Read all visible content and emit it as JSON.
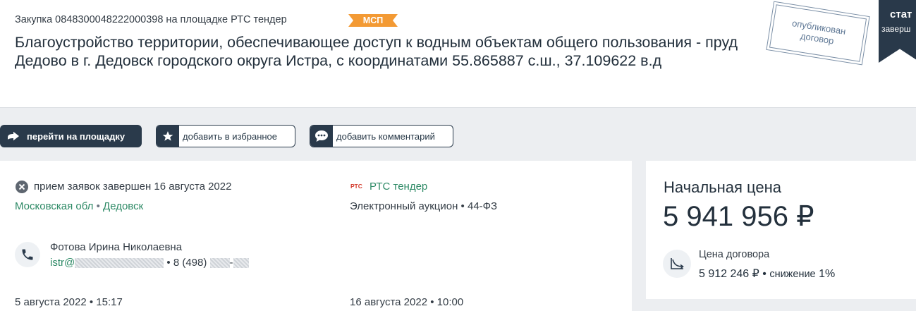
{
  "header": {
    "purchase_line": "Закупка 0848300048222000398 на площадке РТС тендер",
    "badge": "МСП",
    "title": "Благоустройство территории, обеспечивающее доступ к водным объектам общего пользования - пруд Дедово в г. Дедовск городского округа Истра, с координатами 55.865887 с.ш., 37.109622 в.д",
    "stamp": "опубликован договор",
    "status_title": "стат",
    "status_sub": "заверш"
  },
  "actions": {
    "go_platform": "перейти на площадку",
    "add_favorite": "добавить в избранное",
    "add_comment": "добавить комментарий"
  },
  "details": {
    "status_text": "прием заявок завершен 16 августа 2022",
    "region": "Московская обл",
    "separator": "•",
    "city": "Дедовск",
    "platform_logo": "РТС",
    "platform": "РТС тендер",
    "procedure": "Электронный аукцион • 44-ФЗ",
    "contact_name": "Фотова Ирина Николаевна",
    "email_prefix": "istr@",
    "phone_prefix": "• 8 (498)",
    "phone_dash": "-",
    "date_start": "5 августа 2022 • 15:17",
    "date_end": "16 августа 2022 • 10:00"
  },
  "price": {
    "label": "Начальная цена",
    "value": "5 941 956 ₽",
    "contract_label": "Цена договора",
    "contract_value": "5 912 246 ₽",
    "separator": "•",
    "reduction_label": "снижение",
    "reduction_value": "1%"
  },
  "icons": {
    "go": "arrow-right-icon",
    "favorite": "star-icon",
    "comment": "speech-bubble-icon",
    "status": "close-circle-icon",
    "phone": "phone-icon",
    "trend": "trend-down-icon"
  },
  "colors": {
    "dark": "#2a3a4b",
    "accent_green": "#2e8a66",
    "badge_orange": "#f39a34",
    "stamp": "#5f7895",
    "rts_red": "#d33a2c"
  }
}
